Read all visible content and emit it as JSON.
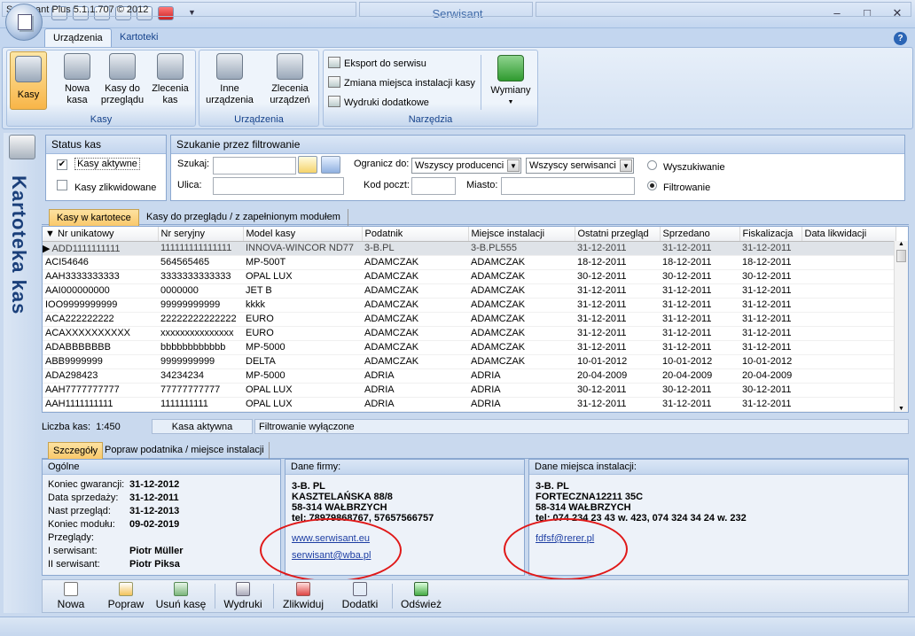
{
  "window": {
    "title": "Serwisant"
  },
  "ribbon": {
    "tabs": [
      {
        "label": "Urządzenia",
        "active": true
      },
      {
        "label": "Kartoteki",
        "active": false
      }
    ],
    "groups": {
      "kasy": {
        "label": "Kasy",
        "buttons": [
          {
            "label": "Kasy",
            "icon": "cash-register-icon"
          },
          {
            "label": "Nowa\nkasa",
            "icon": "new-register-icon"
          },
          {
            "label": "Kasy do\nprzeglądu",
            "icon": "inspect-register-icon"
          },
          {
            "label": "Zlecenia\nkas",
            "icon": "register-orders-icon"
          }
        ]
      },
      "urzadzenia": {
        "label": "Urządzenia",
        "buttons": [
          {
            "label": "Inne\nurządzenia",
            "icon": "scale-icon"
          },
          {
            "label": "Zlecenia\nurządzeń",
            "icon": "device-orders-icon"
          }
        ]
      },
      "narzedzia": {
        "label": "Narzędzia",
        "items": [
          "Eksport do serwisu",
          "Zmiana miejsca instalacji kasy",
          "Wydruki dodatkowe"
        ],
        "wymiany": "Wymiany"
      }
    }
  },
  "sidebar": {
    "title": "Kartoteka kas"
  },
  "status_kas": {
    "title": "Status kas",
    "active_label": "Kasy aktywne",
    "active_checked": true,
    "liquidated_label": "Kasy zlikwidowane",
    "liquidated_checked": false
  },
  "filter": {
    "title": "Szukanie przez filtrowanie",
    "search_label": "Szukaj:",
    "search_value": "",
    "street_label": "Ulica:",
    "street_value": "",
    "limit_label": "Ogranicz do:",
    "producer": "Wszyscy producenci",
    "service": "Wszyscy serwisanci",
    "postcode_label": "Kod poczt:",
    "city_label": "Miasto:",
    "radio_search": "Wyszukiwanie",
    "radio_filter": "Filtrowanie",
    "selected_mode": "Filtrowanie"
  },
  "grid_tabs": [
    "Kasy w kartotece",
    "Kasy do przeglądu / z zapełnionym modułem"
  ],
  "grid": {
    "columns": [
      "Nr unikatowy",
      "Nr seryjny",
      "Model kasy",
      "Podatnik",
      "Miejsce instalacji",
      "Ostatni przegląd",
      "Sprzedano",
      "Fiskalizacja",
      "Data likwidacji"
    ],
    "rows": [
      [
        "ADD1111111111",
        "111111111111111",
        "INNOVA-WINCOR ND77",
        "3-B.PL",
        "3-B.PL555",
        "31-12-2011",
        "31-12-2011",
        "31-12-2011",
        ""
      ],
      [
        "ACI54646",
        "564565465",
        "MP-500T",
        "ADAMCZAK",
        "ADAMCZAK",
        "18-12-2011",
        "18-12-2011",
        "18-12-2011",
        ""
      ],
      [
        "AAH3333333333",
        "3333333333333",
        "OPAL LUX",
        "ADAMCZAK",
        "ADAMCZAK",
        "30-12-2011",
        "30-12-2011",
        "30-12-2011",
        ""
      ],
      [
        "AAI000000000",
        "0000000",
        "JET B",
        "ADAMCZAK",
        "ADAMCZAK",
        "31-12-2011",
        "31-12-2011",
        "31-12-2011",
        ""
      ],
      [
        "IOO9999999999",
        "99999999999",
        "kkkk",
        "ADAMCZAK",
        "ADAMCZAK",
        "31-12-2011",
        "31-12-2011",
        "31-12-2011",
        ""
      ],
      [
        "ACA222222222",
        "22222222222222",
        "EURO",
        "ADAMCZAK",
        "ADAMCZAK",
        "31-12-2011",
        "31-12-2011",
        "31-12-2011",
        ""
      ],
      [
        "ACAXXXXXXXXXX",
        "xxxxxxxxxxxxxxx",
        "EURO",
        "ADAMCZAK",
        "ADAMCZAK",
        "31-12-2011",
        "31-12-2011",
        "31-12-2011",
        ""
      ],
      [
        "ADABBBBBBB",
        "bbbbbbbbbbbb",
        "MP-5000",
        "ADAMCZAK",
        "ADAMCZAK",
        "31-12-2011",
        "31-12-2011",
        "31-12-2011",
        ""
      ],
      [
        "ABB9999999",
        "9999999999",
        "DELTA",
        "ADAMCZAK",
        "ADAMCZAK",
        "10-01-2012",
        "10-01-2012",
        "10-01-2012",
        ""
      ],
      [
        "ADA298423",
        "34234234",
        "MP-5000",
        "ADRIA",
        "ADRIA",
        "20-04-2009",
        "20-04-2009",
        "20-04-2009",
        ""
      ],
      [
        "AAH7777777777",
        "77777777777",
        "OPAL LUX",
        "ADRIA",
        "ADRIA",
        "30-12-2011",
        "30-12-2011",
        "30-12-2011",
        ""
      ],
      [
        "AAH1111111111",
        "1111111111",
        "OPAL LUX",
        "ADRIA",
        "ADRIA",
        "31-12-2011",
        "31-12-2011",
        "31-12-2011",
        ""
      ]
    ]
  },
  "grid_status": {
    "count_label": "Liczba kas:",
    "count_value": "1:450",
    "active": "Kasa aktywna",
    "filter_state": "Filtrowanie wyłączone"
  },
  "detail_tabs": [
    "Szczegóły",
    "Popraw podatnika / miejsce instalacji"
  ],
  "ogolne": {
    "title": "Ogólne",
    "rows": [
      {
        "label": "Koniec gwarancji:",
        "value": "31-12-2012"
      },
      {
        "label": "Data sprzedaży:",
        "value": "31-12-2011"
      },
      {
        "label": "Nast przegląd:",
        "value": "31-12-2013"
      },
      {
        "label": "Koniec modułu:",
        "value": "09-02-2019"
      },
      {
        "label": "Przeglądy:",
        "value": ""
      },
      {
        "label": "I serwisant:",
        "value": "Piotr Müller"
      },
      {
        "label": "II serwisant:",
        "value": "Piotr Piksa"
      }
    ]
  },
  "firma": {
    "title": "Dane firmy:",
    "name": "3-B. PL",
    "street": "KASZTELAŃSKA 88/8",
    "city": "58-314 WAŁBRZYCH",
    "tel": "tel: 78979868767, 57657566757",
    "www": "www.serwisant.eu",
    "email": "serwisant@wba.pl"
  },
  "miejsce": {
    "title": "Dane miejsca instalacji:",
    "name": "3-B. PL",
    "street": "FORTECZNA12211 35C",
    "city": "58-314 WAŁBRZYCH",
    "tel": "tel: 074 234 23 43 w. 423, 074 324 34 24 w. 232",
    "email": "fdfsf@rerer.pl"
  },
  "toolbar": {
    "nowa": "Nowa",
    "popraw": "Popraw",
    "usun": "Usuń kasę",
    "wydruki": "Wydruki",
    "zlikwiduj": "Zlikwiduj",
    "dodatki": "Dodatki",
    "odswiez": "Odśwież"
  },
  "statusbar": {
    "version": "Serwisant Plus 5.1.1.707 © 2012"
  },
  "colors": {
    "accent": "#15428b",
    "highlight_ring": "#e01818",
    "selected_tab": "#f9c86a"
  }
}
